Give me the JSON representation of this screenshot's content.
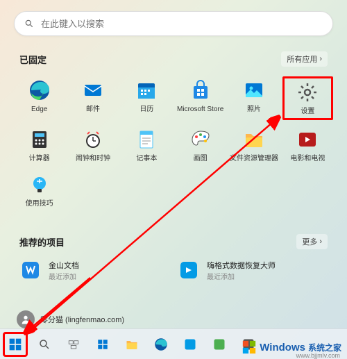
{
  "search": {
    "placeholder": "在此键入以搜索"
  },
  "pinned": {
    "title": "已固定",
    "action": "所有应用",
    "apps": [
      {
        "label": "Edge"
      },
      {
        "label": "邮件"
      },
      {
        "label": "日历"
      },
      {
        "label": "Microsoft Store"
      },
      {
        "label": "照片"
      },
      {
        "label": "设置"
      },
      {
        "label": "计算器"
      },
      {
        "label": "闹钟和时钟"
      },
      {
        "label": "记事本"
      },
      {
        "label": "画图"
      },
      {
        "label": "文件资源管理器"
      },
      {
        "label": "电影和电视"
      },
      {
        "label": "使用技巧"
      }
    ]
  },
  "recommended": {
    "title": "推荐的项目",
    "action": "更多",
    "items": [
      {
        "title": "金山文档",
        "sub": "最近添加"
      },
      {
        "title": "嗨格式数据恢复大师",
        "sub": "最近添加"
      }
    ]
  },
  "user": {
    "name": "零分猫 (lingfenmao.com)"
  },
  "watermark": {
    "brand": "Windows",
    "sub": "系统之家",
    "url": "www.bjjmlv.com"
  }
}
